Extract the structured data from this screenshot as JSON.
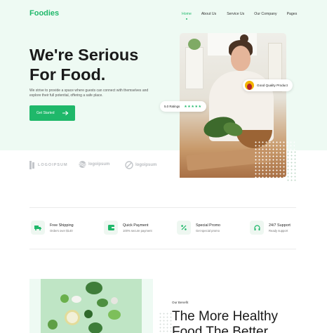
{
  "brand": {
    "name": "Foodies",
    "accent": "#1fb86a",
    "hero_bg": "#eefaf3"
  },
  "nav": {
    "items": [
      {
        "label": "Home",
        "active": true
      },
      {
        "label": "About Us",
        "active": false
      },
      {
        "label": "Service Us",
        "active": false
      },
      {
        "label": "Our Company",
        "active": false
      },
      {
        "label": "Pages",
        "active": false
      }
    ]
  },
  "hero": {
    "headline_line1": "We're Serious",
    "headline_line2": "For Food.",
    "subtext": "We strive to provide a space where guests can connect with themselves and explore their full potential, offering a safe place.",
    "cta_label": "Get Started",
    "quality_badge": "Good Quality Product",
    "ratings_label": "5.0 Ratings",
    "ratings_stars": "★★★★★",
    "rating_value": 5
  },
  "partners": [
    {
      "name": "LOGOIPSUM",
      "icon": "stack-logo-icon"
    },
    {
      "name": "logoipsum",
      "icon": "wave-logo-icon"
    },
    {
      "name": "logoipsum",
      "icon": "circle-slash-logo-icon"
    }
  ],
  "features": [
    {
      "title": "Free Shipping",
      "subtitle": "Orders over $140",
      "icon": "truck-icon"
    },
    {
      "title": "Quick Payment",
      "subtitle": "100% secure payment",
      "icon": "wallet-icon"
    },
    {
      "title": "Special Promo",
      "subtitle": "Get special promo",
      "icon": "percent-icon"
    },
    {
      "title": "24/7 Support",
      "subtitle": "Ready support",
      "icon": "headset-icon"
    }
  ],
  "benefit": {
    "eyebrow": "Our Benefit",
    "title_line1": "The More Healthy",
    "title_line2": "Food The Better"
  }
}
